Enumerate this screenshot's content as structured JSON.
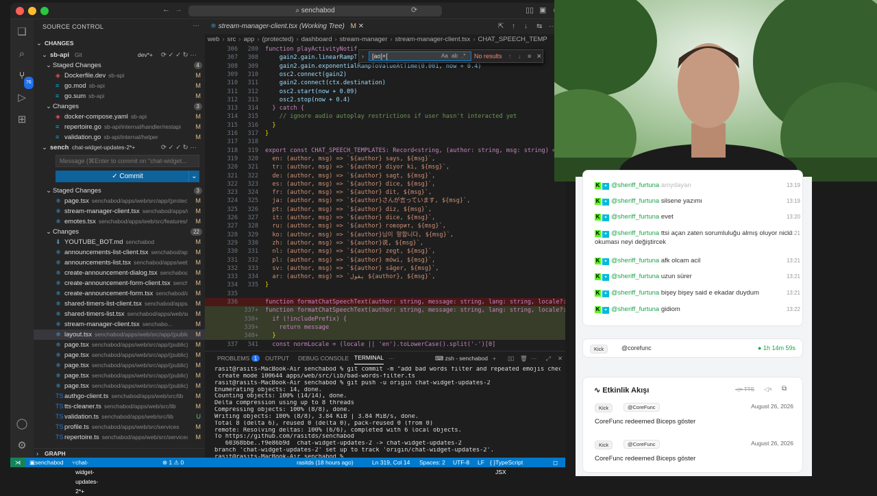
{
  "window": {
    "command_center": "senchabod"
  },
  "sidebar": {
    "title": "SOURCE CONTROL",
    "changes_header": "CHANGES",
    "repo1": {
      "name": "sb-api",
      "type": "Git",
      "branch": "dev*+"
    },
    "staged1": {
      "label": "Staged Changes",
      "count": "4"
    },
    "staged1_items": [
      {
        "name": "Dockerfile.dev",
        "path": "sb-api",
        "status": "M"
      },
      {
        "name": "go.mod",
        "path": "sb-api",
        "status": "M"
      },
      {
        "name": "go.sum",
        "path": "sb-api",
        "status": "M"
      }
    ],
    "changes1": {
      "label": "Changes",
      "count": "3"
    },
    "changes1_items": [
      {
        "name": "docker-compose.yaml",
        "path": "sb-api",
        "status": "M"
      },
      {
        "name": "repertoire.go",
        "path": "sb-api/internal/handler/restapi",
        "status": "M"
      },
      {
        "name": "validation.go",
        "path": "sb-api/internal/helper",
        "status": "M"
      }
    ],
    "repo2": {
      "name": "sench",
      "branch": "chat-widget-updates-2*+"
    },
    "message_placeholder": "Message (⌘Enter to commit on \"chat-widget...",
    "commit_label": "✓ Commit",
    "staged2": {
      "label": "Staged Changes",
      "count": "3"
    },
    "staged2_items": [
      {
        "name": "page.tsx",
        "path": "senchabod/apps/web/src/app/(protected)...",
        "status": "M"
      },
      {
        "name": "stream-manager-client.tsx",
        "path": "senchabod/apps/web...",
        "status": "M"
      },
      {
        "name": "emotes.tsx",
        "path": "senchabod/apps/web/src/features/wid...",
        "status": "M"
      }
    ],
    "changes2": {
      "label": "Changes",
      "count": "22"
    },
    "changes2_items": [
      {
        "name": "YOUTUBE_BOT.md",
        "path": "senchabod",
        "status": "M"
      },
      {
        "name": "announcements-list-client.tsx",
        "path": "senchabod/apps/...",
        "status": "M"
      },
      {
        "name": "announcements-list.tsx",
        "path": "senchabod/apps/web/src...",
        "status": "M"
      },
      {
        "name": "create-announcement-dialog.tsx",
        "path": "senchabod/ap...",
        "status": "M"
      },
      {
        "name": "create-announcement-form-client.tsx",
        "path": "senchab...",
        "status": "M"
      },
      {
        "name": "create-announcement-form.tsx",
        "path": "senchabod/apps...",
        "status": "M"
      },
      {
        "name": "shared-timers-list-client.tsx",
        "path": "senchabod/apps/we...",
        "status": "M"
      },
      {
        "name": "shared-timers-list.tsx",
        "path": "senchabod/apps/web/src/a...",
        "status": "M"
      },
      {
        "name": "stream-manager-client.tsx",
        "path": "senchabo...",
        "status": "M"
      },
      {
        "name": "layout.tsx",
        "path": "senchabod/apps/web/src/app/(public)/[...",
        "status": "M"
      },
      {
        "name": "page.tsx",
        "path": "senchabod/apps/web/src/app/(public)/[u...",
        "status": "M"
      },
      {
        "name": "page.tsx",
        "path": "senchabod/apps/web/src/app/(public)/[u...",
        "status": "M"
      },
      {
        "name": "page.tsx",
        "path": "senchabod/apps/web/src/app/(public)/[u...",
        "status": "M"
      },
      {
        "name": "page.tsx",
        "path": "senchabod/apps/web/src/app/(public)/[u...",
        "status": "M"
      },
      {
        "name": "page.tsx",
        "path": "senchabod/apps/web/src/app/(public)/commands...",
        "status": "M"
      },
      {
        "name": "authgo-client.ts",
        "path": "senchabod/apps/web/src/lib",
        "status": "M"
      },
      {
        "name": "tts-cleaner.ts",
        "path": "senchabod/apps/web/src/lib",
        "status": "M"
      },
      {
        "name": "validation.ts",
        "path": "senchabod/apps/web/src/lib",
        "status": "U"
      },
      {
        "name": "profile.ts",
        "path": "senchabod/apps/web/src/services",
        "status": "M"
      },
      {
        "name": "repertoire.ts",
        "path": "senchabod/apps/web/src/services",
        "status": "M"
      }
    ],
    "graph_label": "GRAPH"
  },
  "editor": {
    "tab_title": "stream-manager-client.tsx (Working Tree)",
    "tab_badge": "M",
    "breadcrumbs": [
      "web",
      "src",
      "app",
      "(protected)",
      "dashboard",
      "stream-manager",
      "stream-manager-client.tsx",
      "CHAT_SPEECH_TEMP"
    ],
    "find": {
      "value": "[ao]+[",
      "results": "No results"
    },
    "lines": [
      {
        "a": "306",
        "b": "280",
        "t": "function playActivityNotif"
      },
      {
        "a": "307",
        "b": "308",
        "t": "    gain2.gain.linearRampT"
      },
      {
        "a": "308",
        "b": "309",
        "t": "    gain2.gain.exponentialRampToValueAtTime(0.001, now + 0.4)"
      },
      {
        "a": "309",
        "b": "310",
        "t": "    osc2.connect(gain2)"
      },
      {
        "a": "310",
        "b": "311",
        "t": "    gain2.connect(ctx.destination)"
      },
      {
        "a": "311",
        "b": "312",
        "t": "    osc2.start(now + 0.09)"
      },
      {
        "a": "312",
        "b": "313",
        "t": "    osc2.stop(now + 0.4)"
      },
      {
        "a": "313",
        "b": "314",
        "t": "  } catch {"
      },
      {
        "a": "314",
        "b": "315",
        "t": "    // ignore audio autoplay restrictions if user hasn't interacted yet"
      },
      {
        "a": "315",
        "b": "316",
        "t": "  }"
      },
      {
        "a": "316",
        "b": "317",
        "t": "}"
      },
      {
        "a": "317",
        "b": "318",
        "t": ""
      },
      {
        "a": "318",
        "b": "319",
        "t": "export const CHAT_SPEECH_TEMPLATES: Record<string, (author: string, msg: string) => st"
      },
      {
        "a": "319",
        "b": "320",
        "t": "  en: (author, msg) => `${author} says, ${msg}`,"
      },
      {
        "a": "320",
        "b": "321",
        "t": "  tr: (author, msg) => `${author} diyor ki, ${msg}`,"
      },
      {
        "a": "321",
        "b": "322",
        "t": "  de: (author, msg) => `${author} sagt, ${msg}`,"
      },
      {
        "a": "322",
        "b": "323",
        "t": "  es: (author, msg) => `${author} dice, ${msg}`,"
      },
      {
        "a": "323",
        "b": "324",
        "t": "  fr: (author, msg) => `${author} dit, ${msg}`,"
      },
      {
        "a": "324",
        "b": "325",
        "t": "  ja: (author, msg) => `${author}さんが言っています, ${msg}`,"
      },
      {
        "a": "325",
        "b": "326",
        "t": "  pt: (author, msg) => `${author} diz, ${msg}`,"
      },
      {
        "a": "326",
        "b": "327",
        "t": "  it: (author, msg) => `${author} dice, ${msg}`,"
      },
      {
        "a": "327",
        "b": "328",
        "t": "  ru: (author, msg) => `${author} говорит, ${msg}`,"
      },
      {
        "a": "328",
        "b": "329",
        "t": "  ko: (author, msg) => `${author}님이 말합니다, ${msg}`,"
      },
      {
        "a": "329",
        "b": "330",
        "t": "  zh: (author, msg) => `${author}说, ${msg}`,"
      },
      {
        "a": "330",
        "b": "331",
        "t": "  nl: (author, msg) => `${author} zegt, ${msg}`,"
      },
      {
        "a": "331",
        "b": "332",
        "t": "  pl: (author, msg) => `${author} mówi, ${msg}`,"
      },
      {
        "a": "332",
        "b": "333",
        "t": "  sv: (author, msg) => `${author} säger, ${msg}`,"
      },
      {
        "a": "333",
        "b": "334",
        "t": "  ar: (author, msg) => `يقول ${author}, ${msg}`,"
      },
      {
        "a": "334",
        "b": "335",
        "t": "}"
      },
      {
        "a": "335",
        "b": "",
        "t": ""
      },
      {
        "a": "336",
        "b": "",
        "t": "function formatChatSpeechText(author: string, message: string, lang: string, locale?: st"
      },
      {
        "a": "",
        "b": "337+",
        "t": "function formatChatSpeechText(author: string, message: string, lang: string, locale?: st"
      },
      {
        "a": "",
        "b": "338+",
        "t": "  if (!includePrefix) {"
      },
      {
        "a": "",
        "b": "339+",
        "t": "    return message"
      },
      {
        "a": "",
        "b": "340+",
        "t": "  }"
      },
      {
        "a": "337",
        "b": "341",
        "t": "  const normLocale = (locale || 'en').toLowerCase().split('-')[0]"
      }
    ]
  },
  "panel": {
    "tabs": [
      "PROBLEMS",
      "OUTPUT",
      "DEBUG CONSOLE",
      "TERMINAL",
      "···"
    ],
    "problems_count": "1",
    "shell": "zsh - senchabod",
    "terminal": [
      "rasit@rasits-MacBook-Air senchabod % git commit -m \"add bad words filter and repeated emojis check to tts\"",
      " create mode 100644 apps/web/src/lib/bad-words-filter.ts",
      "rasit@rasits-MacBook-Air senchabod % git push -u origin chat-widget-updates-2",
      "Enumerating objects: 14, done.",
      "Counting objects: 100% (14/14), done.",
      "Delta compression using up to 8 threads",
      "Compressing objects: 100% (8/8), done.",
      "Writing objects: 100% (8/8), 3.84 KiB | 3.84 MiB/s, done.",
      "Total 8 (delta 6), reused 0 (delta 0), pack-reused 0 (from 0)",
      "remote: Resolving deltas: 100% (6/6), completed with 6 local objects.",
      "To https://github.com/rasitds/senchabod",
      "   60368bbe..f9e86b9d  chat-widget-updates-2 -> chat-widget-updates-2",
      "branch 'chat-widget-updates-2' set up to track 'origin/chat-widget-updates-2'.",
      "rasit@rasits-MacBook-Air senchabod % "
    ]
  },
  "statusbar": {
    "remote": "senchabod",
    "branch": "chat-widget-updates-2*+",
    "problems": "⊗ 1 ⚠ 0",
    "blame": "rasitds (18 hours ago)",
    "position": "Ln 319, Col 14",
    "spaces": "Spaces: 2",
    "encoding": "UTF-8",
    "eol": "LF",
    "language": "TypeScript JSX"
  },
  "chat": {
    "messages": [
      {
        "user": "@sheriff_furtuna",
        "text": "amydayan",
        "time": "13:19"
      },
      {
        "user": "@sheriff_furtuna",
        "text": "silsene yazımı",
        "time": "13:19"
      },
      {
        "user": "@sheriff_furtuna",
        "text": "evet",
        "time": "13:20"
      },
      {
        "user": "@sheriff_furtuna",
        "text": "ttsi açan zaten sorumluluğu almış oluyor nicki okuması neyi değiştircek",
        "time": "13:21"
      },
      {
        "user": "@sheriff_furtuna",
        "text": "afk olcam acil",
        "time": "13:21"
      },
      {
        "user": "@sheriff_furtuna",
        "text": "uzun sürer",
        "time": "13:21"
      },
      {
        "user": "@sheriff_furtuna",
        "text": "bişey bişey said e ekadar duydum",
        "time": "13:21"
      },
      {
        "user": "@sheriff_furtuna",
        "text": "gidiom",
        "time": "13:22"
      }
    ],
    "live": {
      "platform": "Kick",
      "user": "@corefunc",
      "duration": "1h 14m 59s"
    }
  },
  "activity": {
    "title": "Etkinlik Akışı",
    "tts_label": "TTS",
    "events": [
      {
        "platform": "Kick",
        "user": "@CoreFunc",
        "date": "August 26, 2026",
        "text": "CoreFunc redeemed Biceps göster"
      },
      {
        "platform": "Kick",
        "user": "@CoreFunc",
        "date": "August 26, 2026",
        "text": "CoreFunc redeemed Biceps göster"
      }
    ]
  },
  "colors": {
    "accent": "#007acc",
    "kick": "#53fc18",
    "added_line_bg": "#3b4a26"
  }
}
